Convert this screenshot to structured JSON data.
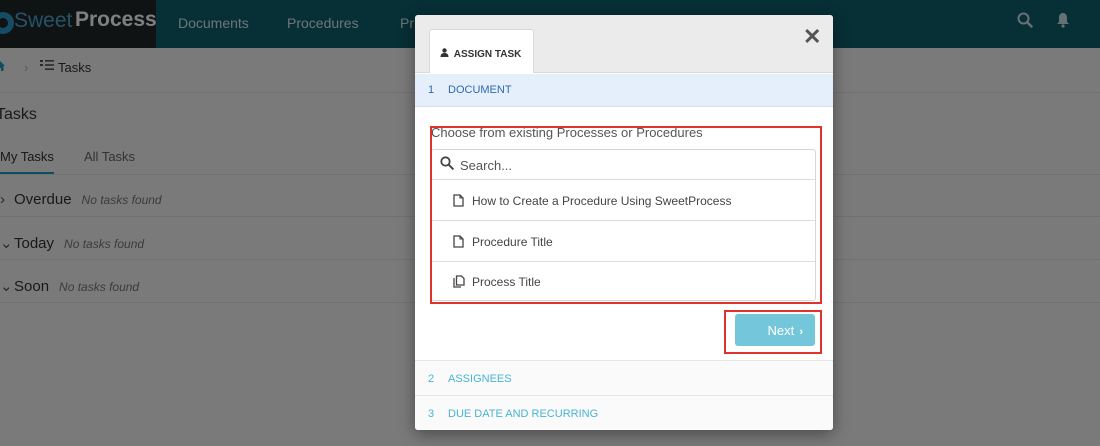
{
  "nav": {
    "brand_light": "Sweet",
    "brand_bold": "Process",
    "links": [
      "Documents",
      "Procedures",
      "Pr"
    ]
  },
  "breadcrumb": {
    "current": "Tasks"
  },
  "page": {
    "title": "Tasks",
    "tabs": [
      "My Tasks",
      "All Tasks"
    ],
    "groups": [
      {
        "label": "Overdue",
        "empty": "No tasks found"
      },
      {
        "label": "Today",
        "empty": "No tasks found"
      },
      {
        "label": "Soon",
        "empty": "No tasks found"
      }
    ]
  },
  "modal": {
    "tab_label": "ASSIGN TASK",
    "steps": [
      {
        "num": "1",
        "label": "DOCUMENT"
      },
      {
        "num": "2",
        "label": "ASSIGNEES"
      },
      {
        "num": "3",
        "label": "DUE DATE AND RECURRING"
      }
    ],
    "choose_label": "Choose from existing Processes or Procedures",
    "search_placeholder": "Search...",
    "items": [
      {
        "label": "How to Create a Procedure Using SweetProcess",
        "icon": "document-icon"
      },
      {
        "label": "Procedure Title",
        "icon": "document-icon"
      },
      {
        "label": "Process Title",
        "icon": "copy-documents-icon"
      }
    ],
    "next_label": "Next"
  },
  "colors": {
    "nav_bg": "#0e5f6d",
    "brand_bg": "#212729",
    "accent": "#1a98c5",
    "next_button": "#74c7db",
    "active_step_bg": "#e4effb",
    "highlight": "#e0332d"
  }
}
